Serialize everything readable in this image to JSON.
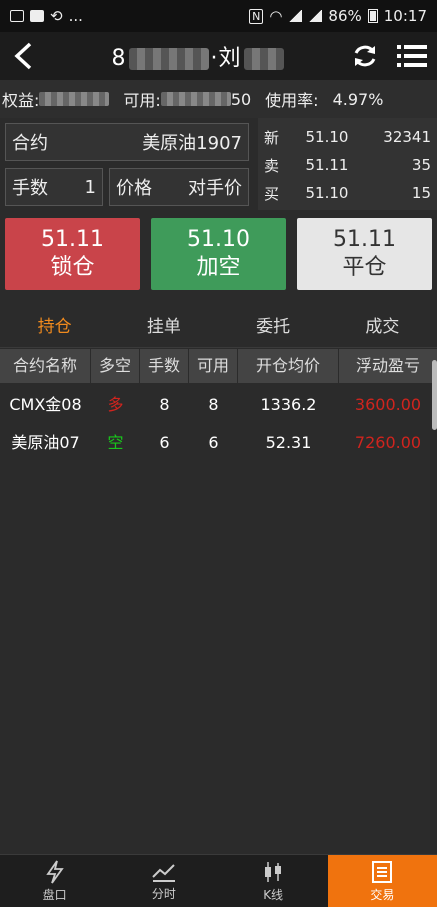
{
  "status_bar": {
    "left_text": "...",
    "battery": "86%",
    "time": "10:17"
  },
  "header": {
    "title_prefix": "8",
    "title_mid": "·刘"
  },
  "account": {
    "equity_label": "权益:",
    "available_label": "可用:",
    "available_suffix": "50",
    "usage_label": "使用率:",
    "usage_value": "4.97%"
  },
  "order": {
    "contract_label": "合约",
    "contract_value": "美原油1907",
    "qty_label": "手数",
    "qty_value": "1",
    "price_label": "价格",
    "price_value": "对手价"
  },
  "quote": [
    {
      "label": "新",
      "price": "51.10",
      "volume": "32341"
    },
    {
      "label": "卖",
      "price": "51.11",
      "volume": "35"
    },
    {
      "label": "买",
      "price": "51.10",
      "volume": "15"
    }
  ],
  "buttons": [
    {
      "price": "51.11",
      "action": "锁仓"
    },
    {
      "price": "51.10",
      "action": "加空"
    },
    {
      "price": "51.11",
      "action": "平仓"
    }
  ],
  "tabs": [
    "持仓",
    "挂单",
    "委托",
    "成交"
  ],
  "table": {
    "headers": [
      "合约名称",
      "多空",
      "手数",
      "可用",
      "开仓均价",
      "浮动盈亏"
    ],
    "rows": [
      {
        "name": "CMX金08",
        "side": "多",
        "qty": "8",
        "avail": "8",
        "avg_price": "1336.2",
        "pnl": "3600.00"
      },
      {
        "name": "美原油07",
        "side": "空",
        "qty": "6",
        "avail": "6",
        "avg_price": "52.31",
        "pnl": "7260.00"
      }
    ]
  },
  "bottom_nav": [
    "盘口",
    "分时",
    "K线",
    "交易"
  ],
  "colors": {
    "accent": "#f0730e",
    "up": "#d0241e",
    "down": "#18c71b",
    "lock": "#c9444a",
    "add_short": "#3f9b5a"
  }
}
